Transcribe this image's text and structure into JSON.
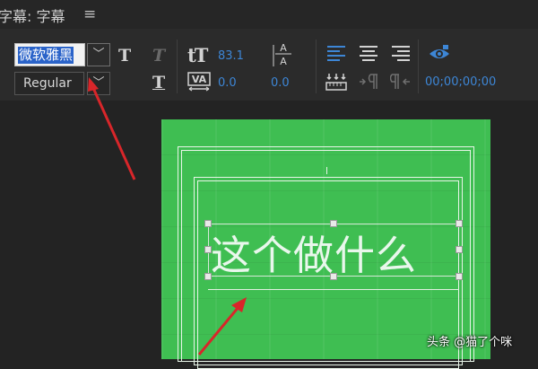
{
  "window": {
    "title": "字幕: 字幕",
    "menu_icon": "hamburger-menu-icon"
  },
  "toolbar": {
    "font_family": "微软雅黑",
    "font_family_visible": "微软雅黑",
    "font_style": "Regular",
    "font_size": "83.1",
    "kerning": "0.0",
    "leading": "0.0",
    "timecode": "00;00;00;00",
    "icons": [
      "bold-icon",
      "italic-icon",
      "underline-icon",
      "font-size-icon",
      "kerning-icon",
      "leading-icon",
      "align-left-icon",
      "align-center-icon",
      "align-right-icon",
      "eye-icon"
    ]
  },
  "canvas": {
    "caption_text": "这个做什么",
    "background_color": "#3fbe52"
  },
  "watermark": "头条 @猫了个咪",
  "colors": {
    "accent": "#3d86d6",
    "selection": "#2a63c9",
    "annotation_arrow": "#d8262a"
  }
}
